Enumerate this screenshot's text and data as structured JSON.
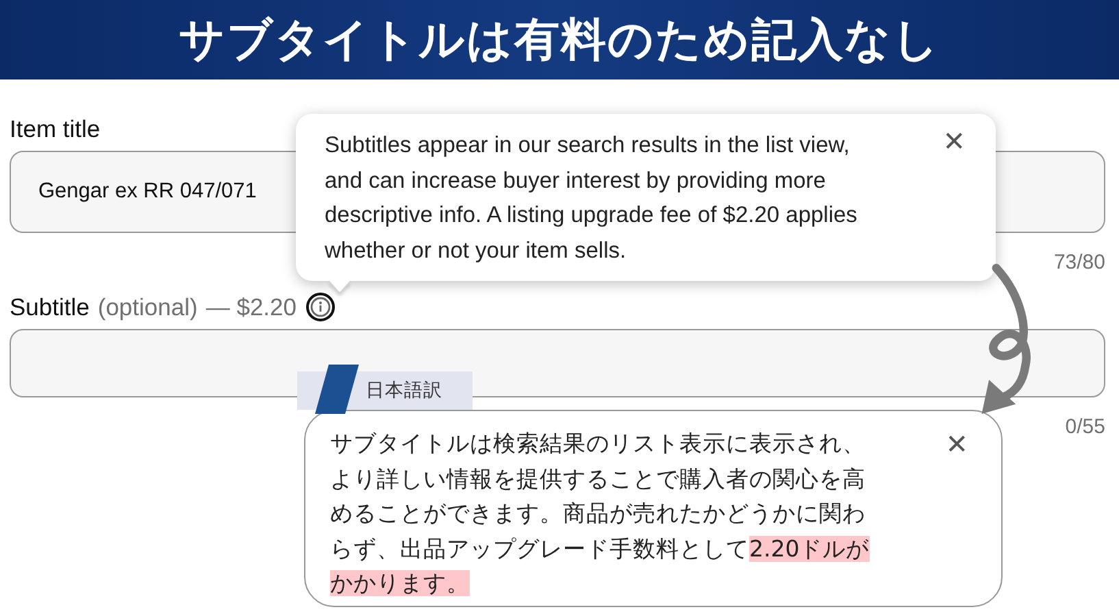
{
  "banner": {
    "title": "サブタイトルは有料のため記入なし"
  },
  "fields": [
    {
      "label": "Item title",
      "value": "Gengar ex RR 047/071",
      "counter": "73/80"
    },
    {
      "label": "Subtitle",
      "label_note": "(optional)",
      "fee": "— $2.20",
      "info_icon": true,
      "counter": "0/55"
    }
  ],
  "tooltip": {
    "text": "Subtitles appear in our search results in the list view, and can increase buyer interest by providing more descriptive info. A listing upgrade fee of $2.20 applies whether or not your item sells.",
    "close": "✕"
  },
  "translation": {
    "tag": "日本語訳",
    "close": "✕",
    "segments": [
      {
        "text": "サブタイトルは検索結果のリスト表示に表示され、より詳しい情報を提供することで購入者の関心を高めることができます。商品が売れたかどうかに関わらず、出品アップグレード手数料として",
        "highlighted": false
      },
      {
        "text": "2.20ドルがかかります。",
        "highlighted": true
      }
    ]
  }
}
